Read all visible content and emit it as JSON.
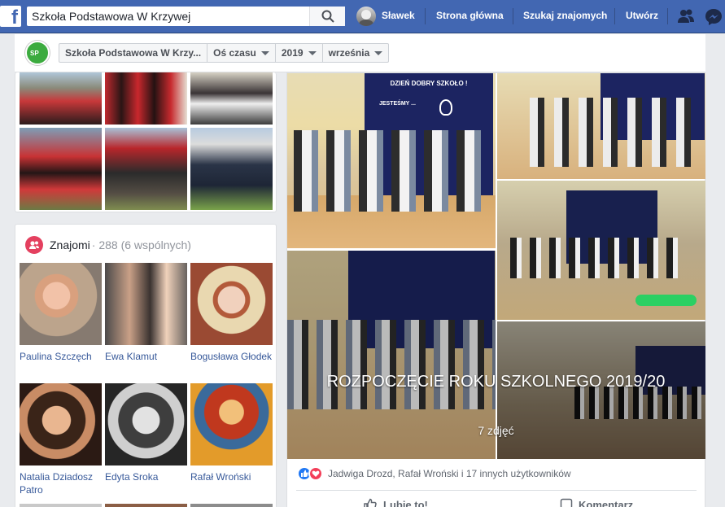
{
  "topbar": {
    "logo": "f",
    "search_value": "Szkoła Podstawowa W Krzywej",
    "search_icon": "search-icon",
    "user_name": "Sławek",
    "nav": [
      "Strona główna",
      "Szukaj znajomych",
      "Utwórz"
    ],
    "icons": [
      "friends-icon",
      "messenger-icon"
    ],
    "brand_color": "#4267b2"
  },
  "subbar": {
    "logo_text": "SP",
    "crumbs": [
      "Szkoła Podstawowa W Krzy...",
      "Oś czasu",
      "2019",
      "września"
    ]
  },
  "friends": {
    "title": "Znajomi",
    "count": "· 288 (6 wspólnych)",
    "items": [
      {
        "name": "Paulina Szczęch"
      },
      {
        "name": "Ewa Klamut"
      },
      {
        "name": "Bogusława Głodek"
      },
      {
        "name": "Natalia Dziadosz Patro"
      },
      {
        "name": "Edyta Sroka"
      },
      {
        "name": "Rafał Wroński"
      }
    ]
  },
  "album": {
    "title": "ROZPOCZĘCIE ROKU SZKOLNEGO 2019/20",
    "count": "7 zdjęć",
    "banner_text": "DZIEŃ DOBRY SZKOŁO !",
    "banner_text2": "JESTEŚMY ...",
    "reactions_text": "Jadwiga Drozd, Rafał Wroński i 17 innych użytkowników",
    "like_label": "Lubię to!",
    "comment_label": "Komentarz"
  }
}
